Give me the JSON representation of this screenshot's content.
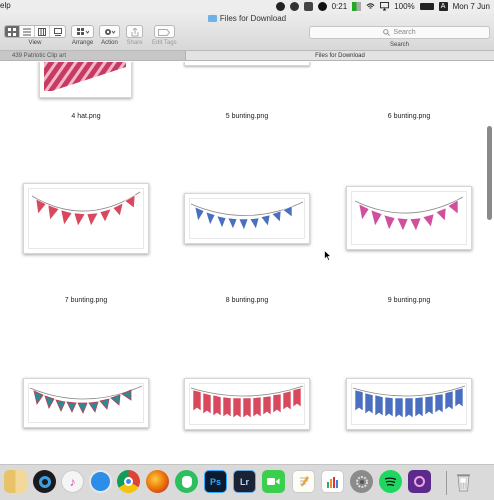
{
  "menubar": {
    "help_fragment": "elp",
    "time": "0:21",
    "battery": "100%",
    "date": "Mon 7 Jun",
    "input_source": "A"
  },
  "window": {
    "title": "Files for Download"
  },
  "toolbar": {
    "view_label": "View",
    "arrange_label": "Arrange",
    "action_label": "Action",
    "share_label": "Share",
    "edit_tags_label": "Edit Tags",
    "search_placeholder": "Search",
    "search_label": "Search"
  },
  "tabs": [
    {
      "label": "439 Patriotic Clip art"
    },
    {
      "label": "Files for Download"
    }
  ],
  "files": [
    {
      "name": "4 hat.png"
    },
    {
      "name": "5 bunting.png"
    },
    {
      "name": "6 bunting.png"
    },
    {
      "name": "7 bunting.png"
    },
    {
      "name": "8 bunting.png"
    },
    {
      "name": "9 bunting.png"
    }
  ],
  "colors": {
    "red": "#d8495e",
    "blue": "#4a6fc0",
    "pink": "#d0509e",
    "teal": "#2e8a92"
  },
  "dock": {
    "apps": [
      "finder-icon",
      "quicktime-icon",
      "itunes-icon",
      "safari-icon",
      "chrome-icon",
      "firefox-icon",
      "evernote-icon",
      "photoshop-icon",
      "lightroom-icon",
      "facetime-icon",
      "textedit-icon",
      "activity-monitor-icon",
      "system-preferences-icon",
      "spotify-icon",
      "screen-recorder-icon",
      "trash-icon"
    ],
    "ps_label": "Ps",
    "lr_label": "Lr"
  }
}
